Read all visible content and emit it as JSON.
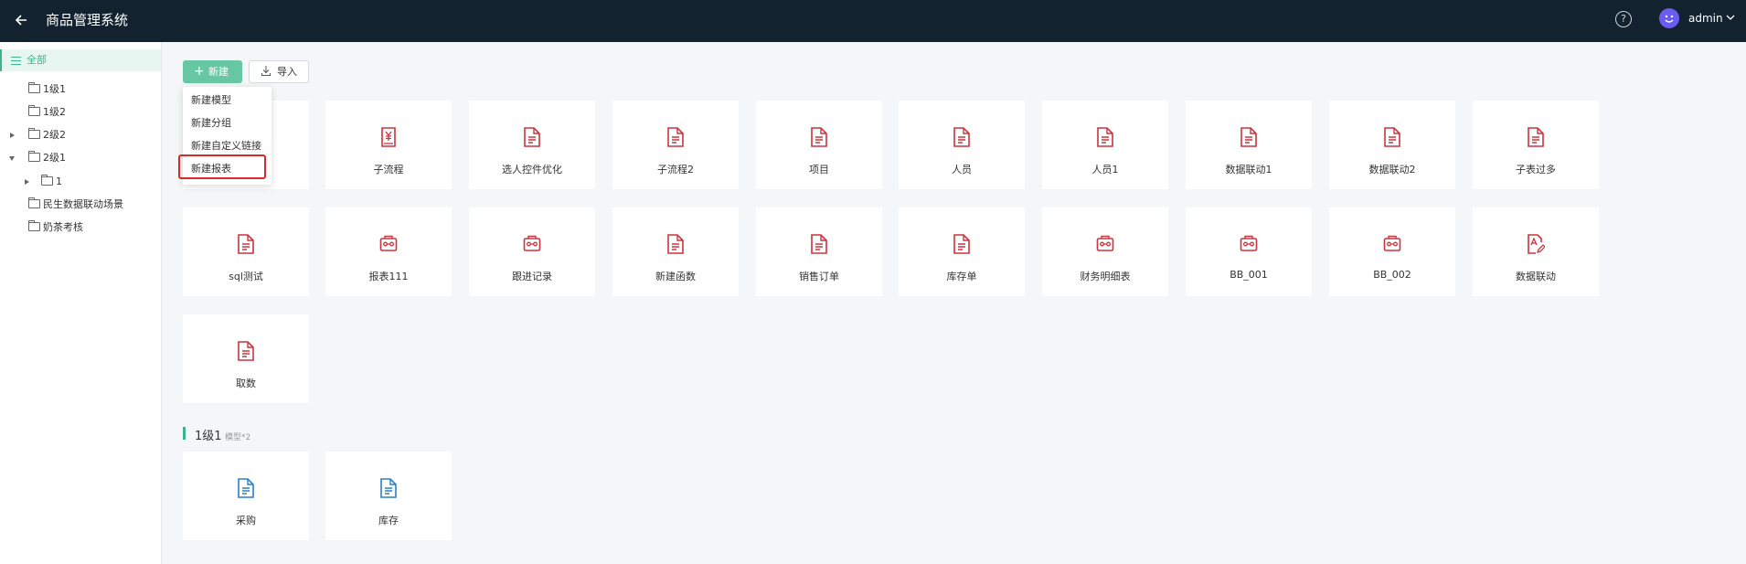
{
  "app": {
    "title": "商品管理系统",
    "user": "admin",
    "avatar_color": "#6a5cf0",
    "accent": "#3fb38a",
    "topbar_color": "#12222e"
  },
  "sidebar": {
    "items": [
      {
        "label": "全部"
      },
      {
        "label": "1级1"
      },
      {
        "label": "1级2"
      },
      {
        "label": "2级2"
      },
      {
        "label": "2级1"
      },
      {
        "label": "1"
      },
      {
        "label": "民生数据联动场景"
      },
      {
        "label": "奶茶考核"
      }
    ]
  },
  "toolbar": {
    "new_label": "新建",
    "import_label": "导入"
  },
  "dropdown": {
    "items": [
      {
        "label": "新建模型"
      },
      {
        "label": "新建分组"
      },
      {
        "label": "新建自定义链接"
      },
      {
        "label": "新建报表"
      }
    ],
    "highlighted": "新建报表"
  },
  "cards": [
    {
      "label": "子流程",
      "icon": "money-doc-icon"
    },
    {
      "label": "选人控件优化",
      "icon": "document-icon"
    },
    {
      "label": "子流程2",
      "icon": "document-icon"
    },
    {
      "label": "项目",
      "icon": "document-icon"
    },
    {
      "label": "人员",
      "icon": "document-icon"
    },
    {
      "label": "人员1",
      "icon": "document-icon"
    },
    {
      "label": "数据联动1",
      "icon": "document-icon"
    },
    {
      "label": "数据联动2",
      "icon": "document-icon"
    },
    {
      "label": "子表过多",
      "icon": "document-icon"
    },
    {
      "label": "sql测试",
      "icon": "document-icon"
    },
    {
      "label": "报表111",
      "icon": "report-icon"
    },
    {
      "label": "跟进记录",
      "icon": "report-icon"
    },
    {
      "label": "新建函数",
      "icon": "document-icon"
    },
    {
      "label": "销售订单",
      "icon": "document-icon"
    },
    {
      "label": "库存单",
      "icon": "document-icon"
    },
    {
      "label": "财务明细表",
      "icon": "report-icon"
    },
    {
      "label": "BB_001",
      "icon": "report-icon"
    },
    {
      "label": "BB_002",
      "icon": "report-icon"
    },
    {
      "label": "数据联动",
      "icon": "edit-doc-icon"
    },
    {
      "label": "取数",
      "icon": "document-icon"
    }
  ],
  "section": {
    "title": "1级1",
    "subtitle": "模型*2",
    "cards": [
      {
        "label": "采购",
        "icon": "document-icon"
      },
      {
        "label": "库存",
        "icon": "document-icon"
      }
    ]
  }
}
